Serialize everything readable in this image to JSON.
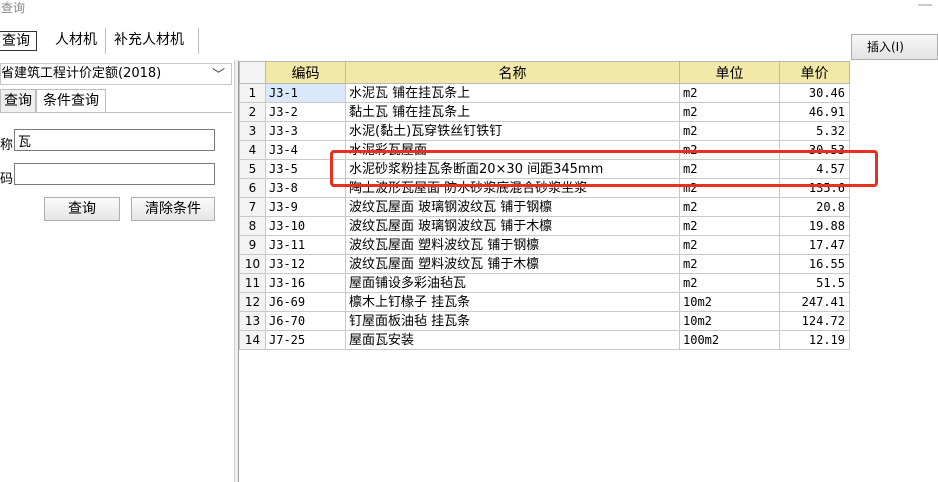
{
  "window": {
    "title": "查询"
  },
  "tabs": [
    "查询",
    "人材机",
    "补充人材机"
  ],
  "insert_button": "插入(I)",
  "left_panel": {
    "quota_library": "省建筑工程计价定额(2018)",
    "subtabs": [
      "查询",
      "条件查询"
    ],
    "name_label": "称:",
    "name_value": "瓦",
    "code_label": "码:",
    "code_value": "",
    "query_button": "查询",
    "clear_button": "清除条件"
  },
  "table": {
    "headers": [
      "编码",
      "名称",
      "单位",
      "单价"
    ],
    "rows": [
      {
        "no": "1",
        "code": "J3-1",
        "name": "水泥瓦 铺在挂瓦条上",
        "unit": "m2",
        "price": "30.46"
      },
      {
        "no": "2",
        "code": "J3-2",
        "name": "黏土瓦 铺在挂瓦条上",
        "unit": "m2",
        "price": "46.91"
      },
      {
        "no": "3",
        "code": "J3-3",
        "name": "水泥(黏土)瓦穿铁丝钉铁钉",
        "unit": "m2",
        "price": "5.32"
      },
      {
        "no": "4",
        "code": "J3-4",
        "name": "水泥彩瓦屋面",
        "unit": "m2",
        "price": "30.53"
      },
      {
        "no": "5",
        "code": "J3-5",
        "name": "水泥砂浆粉挂瓦条断面20×30 间距345mm",
        "unit": "m2",
        "price": "4.57"
      },
      {
        "no": "6",
        "code": "J3-8",
        "name": "陶土波形瓦屋面 防水砂浆底混合砂浆坐浆",
        "unit": "m2",
        "price": "135.6"
      },
      {
        "no": "7",
        "code": "J3-9",
        "name": "波纹瓦屋面 玻璃钢波纹瓦 铺于钢檩",
        "unit": "m2",
        "price": "20.8"
      },
      {
        "no": "8",
        "code": "J3-10",
        "name": "波纹瓦屋面 玻璃钢波纹瓦 铺于木檩",
        "unit": "m2",
        "price": "19.88"
      },
      {
        "no": "9",
        "code": "J3-11",
        "name": "波纹瓦屋面 塑料波纹瓦 铺于钢檩",
        "unit": "m2",
        "price": "17.47"
      },
      {
        "no": "10",
        "code": "J3-12",
        "name": "波纹瓦屋面 塑料波纹瓦 铺于木檩",
        "unit": "m2",
        "price": "16.55"
      },
      {
        "no": "11",
        "code": "J3-16",
        "name": "屋面铺设多彩油毡瓦",
        "unit": "m2",
        "price": "51.5"
      },
      {
        "no": "12",
        "code": "J6-69",
        "name": "檩木上钉椽子 挂瓦条",
        "unit": "10m2",
        "price": "247.41"
      },
      {
        "no": "13",
        "code": "J6-70",
        "name": "钉屋面板油毡 挂瓦条",
        "unit": "10m2",
        "price": "124.72"
      },
      {
        "no": "14",
        "code": "J7-25",
        "name": "屋面瓦安装",
        "unit": "100m2",
        "price": "12.19"
      }
    ]
  },
  "colors": {
    "header_bg": "#f2e8a8",
    "highlight_border": "#e8301e",
    "selected_cell": "#d9e9fb"
  }
}
